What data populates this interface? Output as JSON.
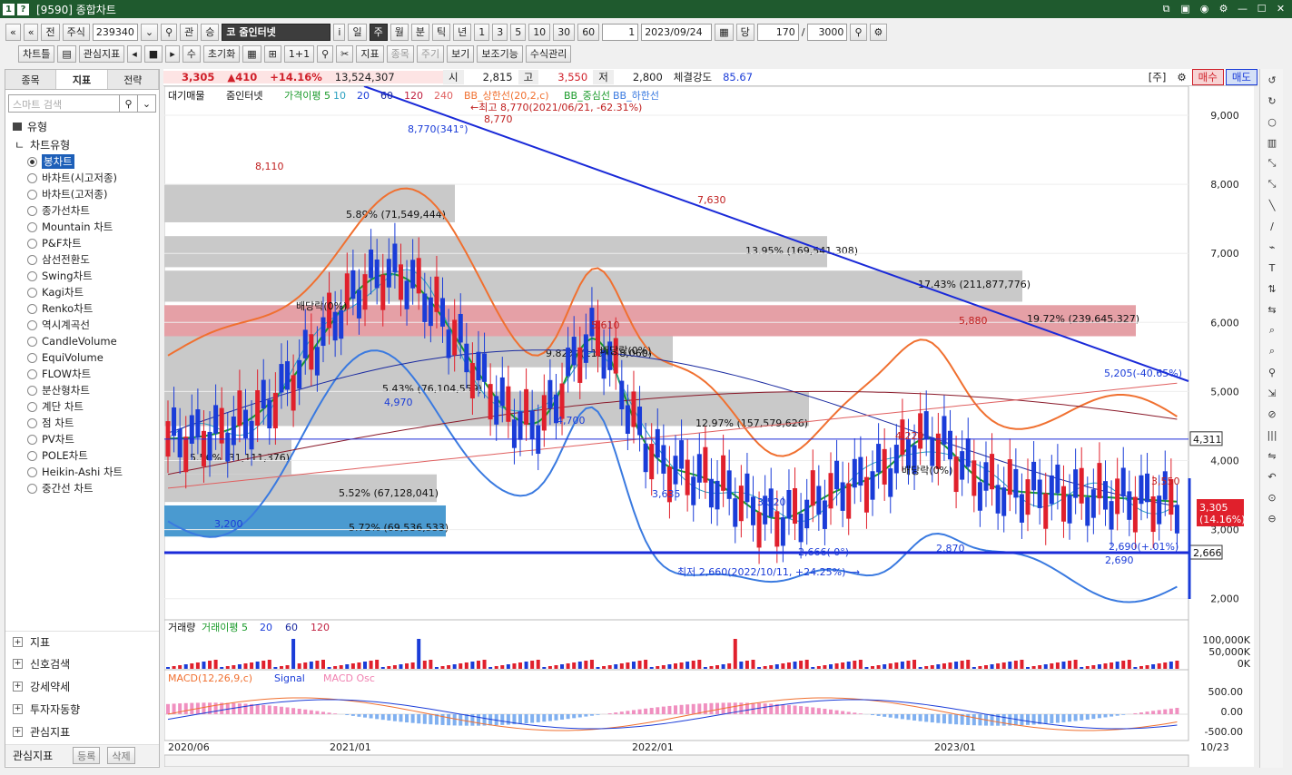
{
  "window": {
    "title": "[9590] 종합차트",
    "icons": [
      "1",
      "?"
    ]
  },
  "toolbar1": {
    "nav_first": "«",
    "nav_up": "«",
    "jeon": "전",
    "market": "주식",
    "code": "239340",
    "search_icon": "search-icon",
    "gwan": "관",
    "sang": "승",
    "stock_name": "코 줌인터넷",
    "info": "i",
    "periods": [
      "일",
      "주",
      "월",
      "분",
      "틱",
      "년"
    ],
    "period_selected": "주",
    "mins": [
      "1",
      "3",
      "5",
      "10",
      "30",
      "60"
    ],
    "count_a": "1",
    "date": "2023/09/24",
    "dang": "당",
    "bars": "170",
    "slash": "/",
    "total": "3000"
  },
  "toolbar2": {
    "chartle": "차트틀",
    "gwansim": "관심지표",
    "su": "수",
    "reset": "초기화",
    "ji": "지표",
    "jong": "종목",
    "ju": "주기",
    "bogi": "보기",
    "bojo": "보조기능",
    "susik": "수식관리"
  },
  "left": {
    "tabs": [
      "종목",
      "지표",
      "전략"
    ],
    "selected_tab": "지표",
    "search_placeholder": "스마트 검색",
    "section": "유형",
    "subsection": "차트유형",
    "items": [
      "봉차트",
      "바차트(시고저종)",
      "바차트(고저종)",
      "종가선차트",
      "Mountain 차트",
      "P&F차트",
      "삼선전환도",
      "Swing차트",
      "Kagi차트",
      "Renko차트",
      "역시계곡선",
      "CandleVolume",
      "EquiVolume",
      "FLOW차트",
      "분산형차트",
      "계단 차트",
      "점 차트",
      "PV차트",
      "POLE차트",
      "Heikin-Ashi 차트",
      "중간선 차트"
    ],
    "bottom": [
      "지표",
      "신호검색",
      "강세약세",
      "투자자동향",
      "관심지표"
    ],
    "footer": {
      "label": "관심지표",
      "register": "등록",
      "delete": "삭제"
    }
  },
  "info": {
    "price": "3,305",
    "change": "▲410",
    "pct": "+14.16%",
    "volume": "13,524,307",
    "open_l": "시",
    "open": "2,815",
    "high_l": "고",
    "high": "3,550",
    "low_l": "저",
    "low": "2,800",
    "str_l": "체결강도",
    "strength": "85.67",
    "ju": "[주]",
    "buy": "매수",
    "sell": "매도"
  },
  "chart": {
    "legend": [
      "대기매물",
      "줌인터넷",
      "가격이평 5",
      "10",
      "20",
      "60",
      "120",
      "240",
      "BB_상한선(20,2,c)",
      "BB_중심선",
      "BB_하한선"
    ],
    "ylabels": [
      "9,000",
      "8,000",
      "7,000",
      "6,000",
      "5,000",
      "4,000",
      "3,000",
      "2,000"
    ],
    "xlabels": [
      "2020/06",
      "2021/01",
      "2022/01",
      "2023/01",
      "10/23"
    ],
    "vp": [
      "5.89% (71,549,444)",
      "13.95% (169,541,308)",
      "17.43% (211,877,776)",
      "19.72% (239,645,327)",
      "5.43% (76,104,559)",
      "12.97% (157,579,626)",
      "5.56% (31,111,376)",
      "5.52% (67,128,041)",
      "5.72% (69,536,533)",
      "9.82% (119,358,060)"
    ],
    "annotations": {
      "hi_label": "8,770",
      "hi_note": "←최고 8,770(2021/06/21, -62.31%)",
      "hi_blue": "8,770(341°)",
      "p8110": "8,110",
      "p7630": "7,630",
      "p5880": "5,880",
      "p5610": "5,610",
      "p4970": "4,970",
      "p4700": "4,700",
      "p3635": "3,635",
      "p3520": "3,520",
      "p3200": "3,200",
      "p4220": "4,220",
      "p3550": "3,550",
      "p2870": "2,870",
      "p2690": "2,690",
      "trend": "5,205(-40.65%)",
      "low_line": "2,666(  0°)",
      "low_note": "최저 2,660(2022/10/11, +24.25%)⟶",
      "div1": "배당락(0%)",
      "div2": "배당락(0%)",
      "div3": "배당락(0%)",
      "right_level": "4,311",
      "right_level2": "2,666",
      "cur_price": "3,305",
      "cur_pct": "(14.16%)",
      "end_pct": "2,690(+.01%)"
    },
    "vol_legend": [
      "거래량",
      "거래이평 5",
      "20",
      "60",
      "120"
    ],
    "vol_ticks": [
      "100,000K",
      "50,000K",
      "0K"
    ],
    "macd_legend": [
      "MACD(12,26,9,c)",
      "Signal",
      "MACD Osc"
    ],
    "macd_ticks": [
      "500.00",
      "0.00",
      "-500.00"
    ]
  },
  "colors": {
    "up": "#e0202c",
    "down": "#1a3cd8",
    "bb_upper": "#f07030",
    "ma20": "#1a9a2a",
    "bb_lower": "#3a7ae0",
    "trend": "#1a2ad8"
  }
}
